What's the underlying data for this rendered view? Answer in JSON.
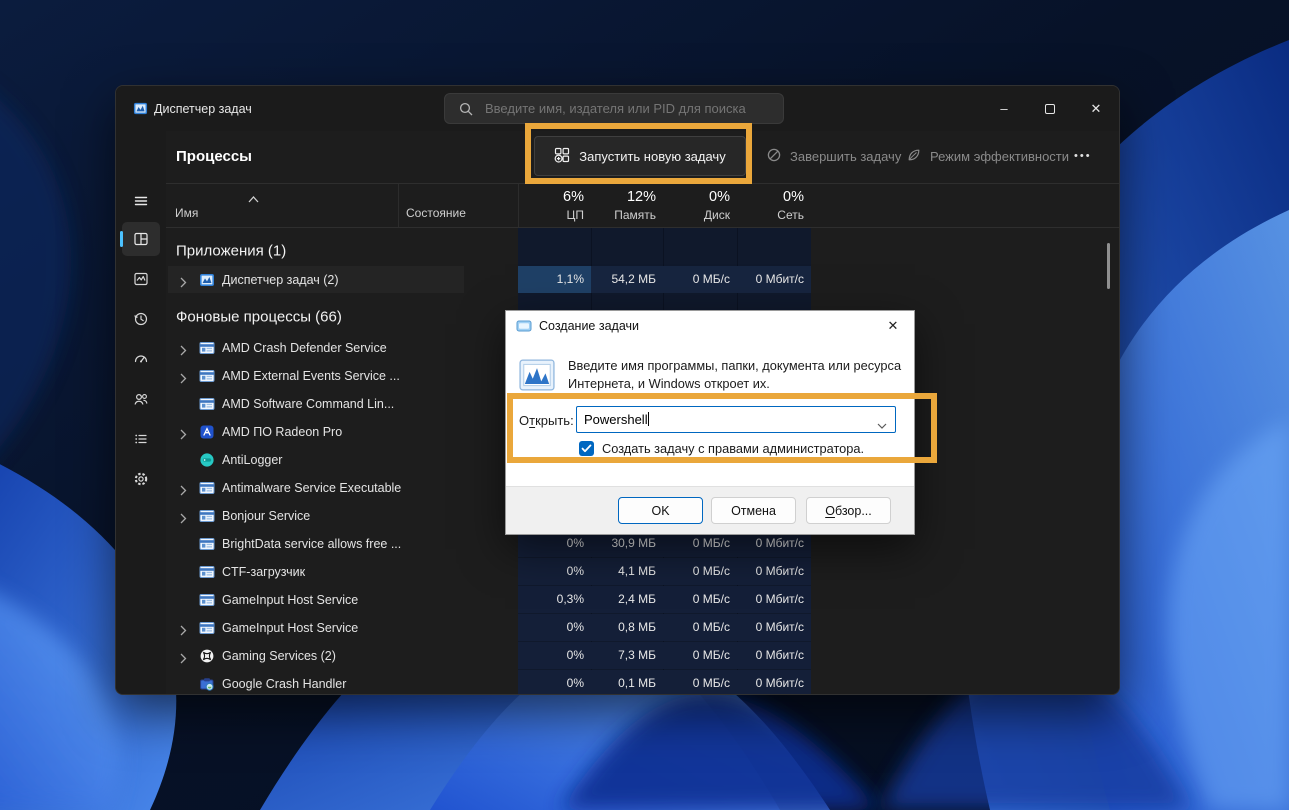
{
  "colors": {
    "accent": "#4CC2FF",
    "highlight": "#EAA73B",
    "dialog_accent": "#0067C0",
    "cell": "#141F38",
    "cell_selected": "#17253F",
    "cell_cpu_selected": "#1F4066"
  },
  "window": {
    "title": "Диспетчер задач",
    "search_placeholder": "Введите имя, издателя или PID для поиска",
    "controls": {
      "minimize": "–",
      "maximize": "",
      "close": "✕"
    }
  },
  "sidebar": {
    "menu_icon": "hamburger",
    "items": [
      {
        "id": "processes",
        "icon": "processes",
        "selected": true
      },
      {
        "id": "performance",
        "icon": "performance",
        "selected": false
      },
      {
        "id": "app-history",
        "icon": "history",
        "selected": false
      },
      {
        "id": "startup-apps",
        "icon": "gauge",
        "selected": false
      },
      {
        "id": "users",
        "icon": "users",
        "selected": false
      },
      {
        "id": "details",
        "icon": "details",
        "selected": false
      },
      {
        "id": "services",
        "icon": "gear",
        "selected": false
      }
    ],
    "settings_icon": "gear"
  },
  "toolbar": {
    "page_title": "Процессы",
    "run_new_task": "Запустить новую задачу",
    "end_task": "Завершить задачу",
    "efficiency_mode": "Режим эффективности",
    "more": "•••"
  },
  "columns": {
    "name": "Имя",
    "status": "Состояние",
    "metrics": [
      {
        "pct": "6%",
        "label": "ЦП"
      },
      {
        "pct": "12%",
        "label": "Память"
      },
      {
        "pct": "0%",
        "label": "Диск"
      },
      {
        "pct": "0%",
        "label": "Сеть"
      }
    ]
  },
  "process_list": [
    {
      "type": "group",
      "label": "Приложения (1)"
    },
    {
      "type": "row",
      "chevron": true,
      "icon": "task-manager-icon",
      "name": "Диспетчер задач (2)",
      "selected": true,
      "values": [
        "1,1%",
        "54,2 МБ",
        "0 МБ/с",
        "0 Мбит/с"
      ]
    },
    {
      "type": "group",
      "label": "Фоновые процессы (66)"
    },
    {
      "type": "row",
      "chevron": true,
      "icon": "app-window-icon",
      "name": "AMD Crash Defender Service",
      "values": null
    },
    {
      "type": "row",
      "chevron": true,
      "icon": "app-window-icon",
      "name": "AMD External Events Service ...",
      "values": null
    },
    {
      "type": "row",
      "chevron": false,
      "icon": "app-window-icon",
      "name": "AMD Software Command Lin...",
      "values": null
    },
    {
      "type": "row",
      "chevron": true,
      "icon": "amd-radeon-icon",
      "name": "AMD ПО Radeon Pro",
      "values": null
    },
    {
      "type": "row",
      "chevron": false,
      "icon": "antilogger-icon",
      "name": "AntiLogger",
      "values": null
    },
    {
      "type": "row",
      "chevron": true,
      "icon": "app-window-icon",
      "name": "Antimalware Service Executable",
      "values": null
    },
    {
      "type": "row",
      "chevron": true,
      "icon": "app-window-icon",
      "name": "Bonjour Service",
      "values": null
    },
    {
      "type": "row",
      "chevron": false,
      "icon": "app-window-icon",
      "name": "BrightData service allows free ...",
      "values": [
        "0%",
        "30,9 МБ",
        "0 МБ/с",
        "0 Мбит/с"
      ]
    },
    {
      "type": "row",
      "chevron": false,
      "icon": "app-window-icon",
      "name": "CTF-загрузчик",
      "values": [
        "0%",
        "4,1 МБ",
        "0 МБ/с",
        "0 Мбит/с"
      ]
    },
    {
      "type": "row",
      "chevron": false,
      "icon": "app-window-icon",
      "name": "GameInput Host Service",
      "values": [
        "0,3%",
        "2,4 МБ",
        "0 МБ/с",
        "0 Мбит/с"
      ]
    },
    {
      "type": "row",
      "chevron": true,
      "icon": "app-window-icon",
      "name": "GameInput Host Service",
      "values": [
        "0%",
        "0,8 МБ",
        "0 МБ/с",
        "0 Мбит/с"
      ]
    },
    {
      "type": "row",
      "chevron": true,
      "icon": "xbox-icon",
      "name": "Gaming Services (2)",
      "values": [
        "0%",
        "7,3 МБ",
        "0 МБ/с",
        "0 Мбит/с"
      ]
    },
    {
      "type": "row",
      "chevron": false,
      "icon": "google-crash-icon",
      "name": "Google Crash Handler",
      "values": [
        "0%",
        "0,1 МБ",
        "0 МБ/с",
        "0 Мбит/с"
      ]
    }
  ],
  "dialog": {
    "title": "Создание задачи",
    "close": "✕",
    "description": "Введите имя программы, папки, документа или ресурса Интернета, и Windows откроет их.",
    "open_label": {
      "pre": "О",
      "key": "т",
      "post": "крыть:"
    },
    "input_value": "Powershell",
    "checkbox_checked": true,
    "checkbox_label": "Создать задачу с правами администратора.",
    "ok": "OK",
    "cancel": "Отмена",
    "browse": {
      "pre": "",
      "key": "О",
      "post": "бзор..."
    }
  }
}
